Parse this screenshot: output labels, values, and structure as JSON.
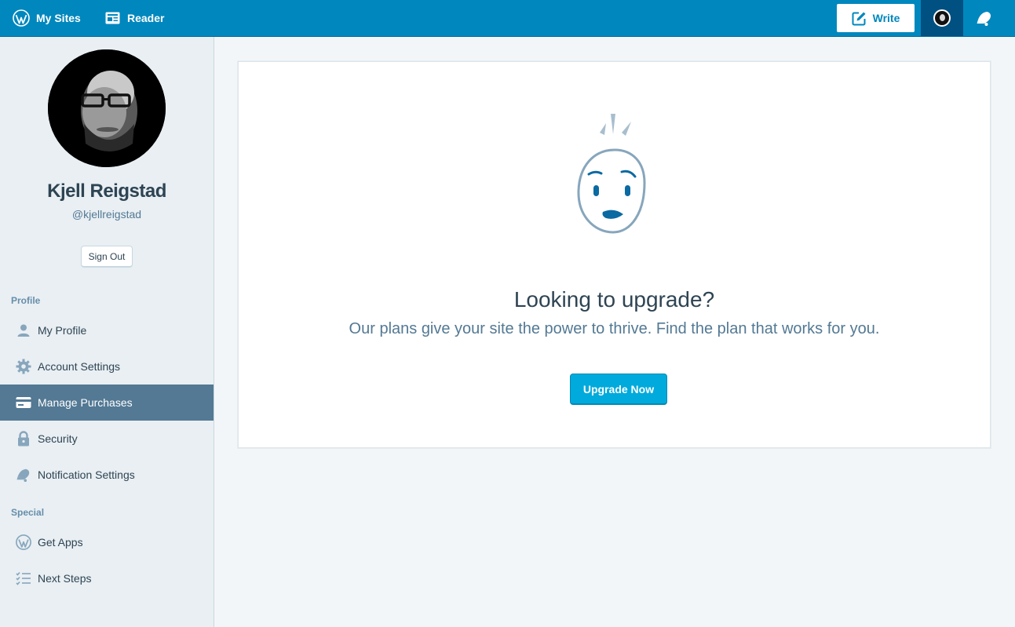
{
  "masterbar": {
    "my_sites_label": "My Sites",
    "reader_label": "Reader",
    "write_label": "Write",
    "icons": {
      "my_sites": "wordpress-logo-icon",
      "reader": "reader-icon",
      "write": "edit-icon",
      "notifications": "bell-icon"
    }
  },
  "profile": {
    "name": "Kjell Reigstad",
    "username": "@kjellreigstad",
    "sign_out_label": "Sign Out"
  },
  "sidebar": {
    "sections": [
      {
        "heading": "Profile"
      },
      {
        "heading": "Special"
      }
    ],
    "items": [
      {
        "label": "My Profile",
        "icon": "user-icon",
        "selected": false
      },
      {
        "label": "Account Settings",
        "icon": "gear-icon",
        "selected": false
      },
      {
        "label": "Manage Purchases",
        "icon": "credit-card-icon",
        "selected": true
      },
      {
        "label": "Security",
        "icon": "lock-icon",
        "selected": false
      },
      {
        "label": "Notification Settings",
        "icon": "bell-icon",
        "selected": false
      },
      {
        "label": "Get Apps",
        "icon": "wordpress-logo-icon",
        "selected": false
      },
      {
        "label": "Next Steps",
        "icon": "checklist-icon",
        "selected": false
      }
    ]
  },
  "main": {
    "title": "Looking to upgrade?",
    "line": "Our plans give your site the power to thrive. Find the plan that works for you.",
    "button_label": "Upgrade Now",
    "illustration": "surprised-face-illustration"
  },
  "colors": {
    "masterbar": "#0087be",
    "accent_button": "#00aadc",
    "selected_nav": "#537994",
    "sidebar_bg": "#e9eff3",
    "page_bg": "#f3f6f8"
  }
}
